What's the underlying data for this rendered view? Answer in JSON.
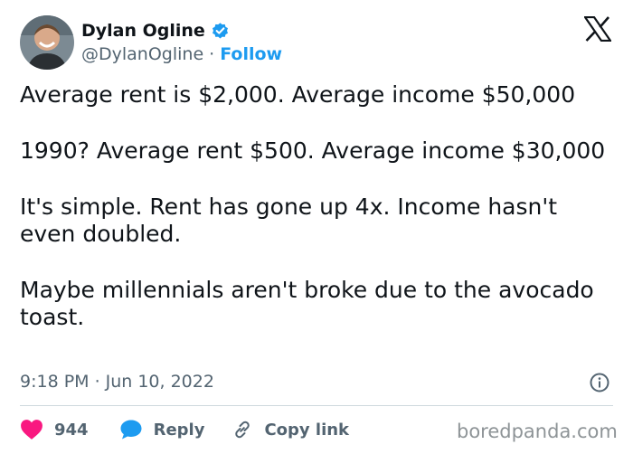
{
  "author": {
    "display_name": "Dylan Ogline",
    "handle": "@DylanOgline",
    "separator": "·",
    "follow_label": "Follow"
  },
  "icons": {
    "verified": "verified-badge-icon",
    "platform": "x-logo-icon",
    "info": "info-icon",
    "like": "heart-icon",
    "reply": "speech-bubble-icon",
    "copy_link": "link-icon"
  },
  "tweet": {
    "paragraphs": [
      "Average rent is $2,000. Average income $50,000",
      "1990? Average rent $500. Average income $30,000",
      "It's simple. Rent has gone up 4x. Income hasn't even doubled.",
      "Maybe millennials aren't broke due to the avocado toast."
    ],
    "time": "9:18 PM",
    "date_separator": "·",
    "date": "Jun 10, 2022"
  },
  "actions": {
    "like_count": "944",
    "reply_label": "Reply",
    "copy_link_label": "Copy link"
  },
  "watermark": "boredpanda.com",
  "colors": {
    "accent": "#1d9bf0",
    "like": "#f91880",
    "text_primary": "#0f1419",
    "text_secondary": "#536471",
    "divider": "#cfd9de"
  }
}
